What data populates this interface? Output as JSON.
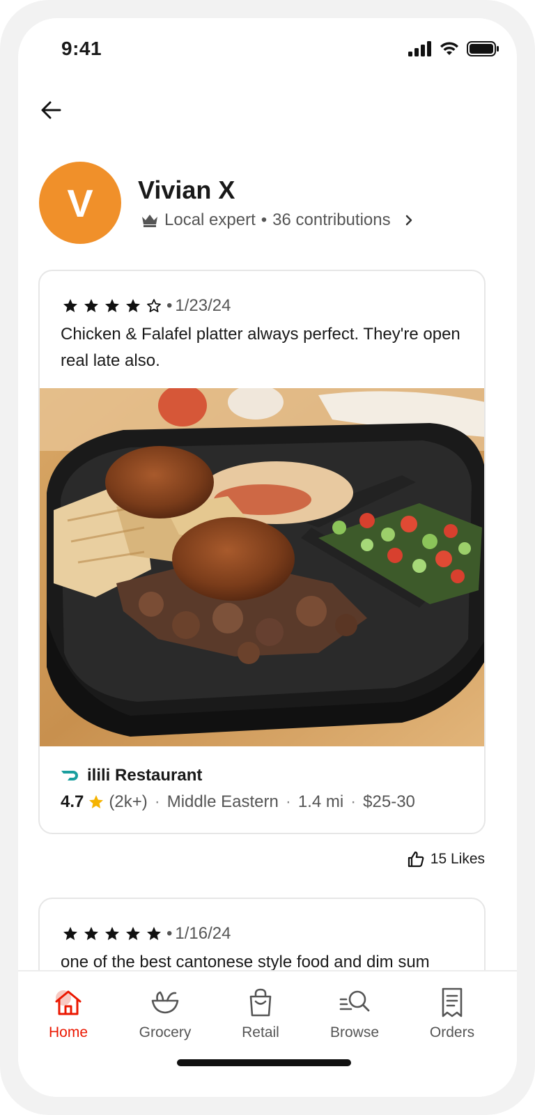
{
  "status_bar": {
    "time": "9:41"
  },
  "profile": {
    "initial": "V",
    "name": "Vivian X",
    "badge": "Local expert",
    "contributions": "36 contributions"
  },
  "reviews": [
    {
      "stars": 4,
      "date": "1/23/24",
      "text": "Chicken & Falafel platter always perfect. They're open real late also.",
      "restaurant": {
        "name": "ilili Restaurant",
        "rating": "4.7",
        "count": "(2k+)",
        "cuisine": "Middle Eastern",
        "distance": "1.4 mi",
        "price": "$25-30"
      },
      "likes": "15 Likes"
    },
    {
      "stars": 5,
      "date": "1/16/24",
      "text": "one of the best cantonese style food and dim sum"
    }
  ],
  "tabbar": {
    "tabs": [
      {
        "label": "Home",
        "active": true
      },
      {
        "label": "Grocery"
      },
      {
        "label": "Retail"
      },
      {
        "label": "Browse"
      },
      {
        "label": "Orders"
      }
    ]
  },
  "colors": {
    "accent": "#eb1700",
    "avatar": "#f0902a",
    "star": "#f5b301",
    "brand_teal": "#1a9e9e"
  }
}
